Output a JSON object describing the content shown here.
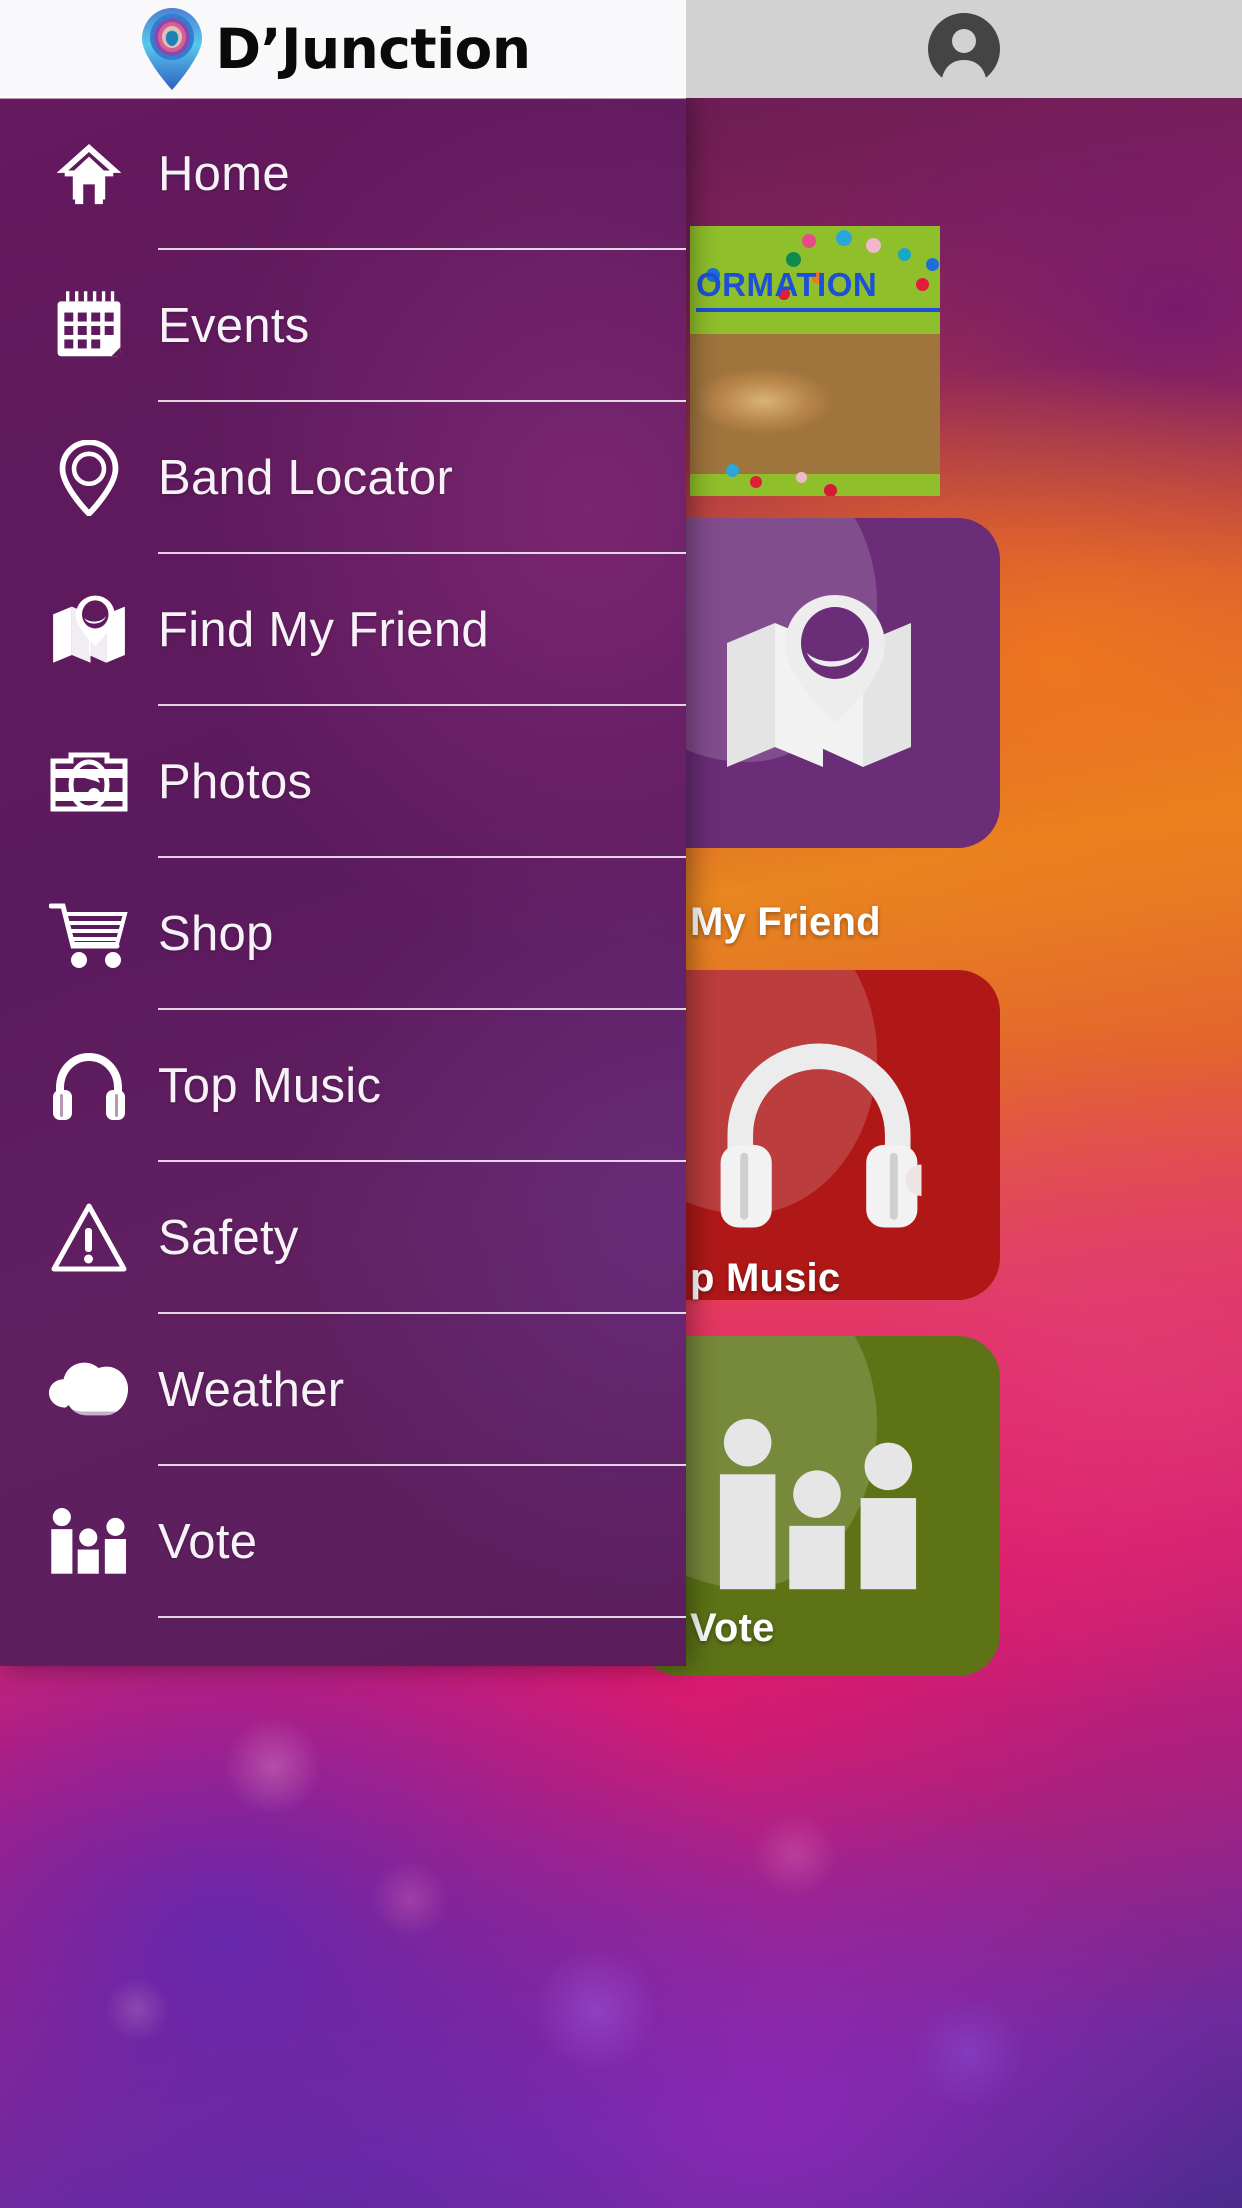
{
  "header": {
    "brand_title": "D’Junction",
    "logo_icon": "location-pin-peacock-logo",
    "avatar_icon": "account-circle-icon"
  },
  "drawer": {
    "items": [
      {
        "label": "Home",
        "icon": "home-icon"
      },
      {
        "label": "Events",
        "icon": "calendar-icon"
      },
      {
        "label": "Band Locator",
        "icon": "map-pin-icon"
      },
      {
        "label": "Find My Friend",
        "icon": "map-with-pin-icon"
      },
      {
        "label": "Photos",
        "icon": "camera-icon"
      },
      {
        "label": "Shop",
        "icon": "shopping-cart-icon"
      },
      {
        "label": "Top Music",
        "icon": "headphones-icon"
      },
      {
        "label": "Safety",
        "icon": "warning-triangle-icon"
      },
      {
        "label": "Weather",
        "icon": "cloud-icon"
      },
      {
        "label": "Vote",
        "icon": "podium-people-icon"
      }
    ]
  },
  "app_content": {
    "info_card": {
      "title": "ORMATION",
      "background_color": "#8fbf2a",
      "title_color": "#1d4fd8"
    },
    "tiles": [
      {
        "label": "My Friend",
        "icon": "map-with-pin-icon",
        "color": "#6b2c78"
      },
      {
        "label": "p Music",
        "icon": "headphones-icon",
        "color": "#b01818"
      },
      {
        "label": "Vote",
        "icon": "podium-people-icon",
        "color": "#5d7316"
      }
    ]
  },
  "colors": {
    "drawer_purple": "#5e1a5c",
    "header_bg": "#f9f9fb",
    "header_right_bg": "#d2d2d2",
    "divider": "#ffffff",
    "label_text": "#f7f2f7"
  }
}
